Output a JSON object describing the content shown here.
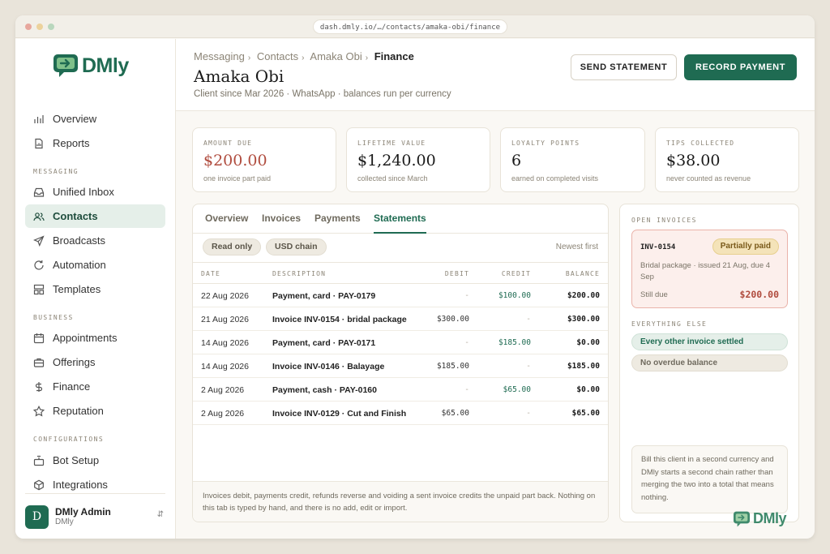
{
  "browser": {
    "url": "dash.dmly.io/…/contacts/amaka-obi/finance"
  },
  "brand": {
    "name": "DMly"
  },
  "sidebar": {
    "top_items": [
      {
        "label": "Overview",
        "icon": "bar-chart-icon"
      },
      {
        "label": "Reports",
        "icon": "report-icon"
      }
    ],
    "sections": [
      {
        "title": "MESSAGING",
        "items": [
          {
            "label": "Unified Inbox",
            "icon": "inbox-icon"
          },
          {
            "label": "Contacts",
            "icon": "users-icon",
            "active": true
          },
          {
            "label": "Broadcasts",
            "icon": "send-icon"
          },
          {
            "label": "Automation",
            "icon": "refresh-icon"
          },
          {
            "label": "Templates",
            "icon": "template-icon"
          }
        ]
      },
      {
        "title": "BUSINESS",
        "items": [
          {
            "label": "Appointments",
            "icon": "calendar-icon"
          },
          {
            "label": "Offerings",
            "icon": "briefcase-icon"
          },
          {
            "label": "Finance",
            "icon": "dollar-icon"
          },
          {
            "label": "Reputation",
            "icon": "star-icon"
          }
        ]
      },
      {
        "title": "CONFIGURATIONS",
        "items": [
          {
            "label": "Bot Setup",
            "icon": "bot-icon"
          },
          {
            "label": "Integrations",
            "icon": "cube-icon"
          }
        ]
      }
    ],
    "user": {
      "initial": "D",
      "name": "DMly Admin",
      "org": "DMly"
    }
  },
  "header": {
    "breadcrumbs": [
      "Messaging",
      "Contacts",
      "Amaka Obi",
      "Finance"
    ],
    "title": "Amaka Obi",
    "subtitle": "Client since Mar 2026 · WhatsApp · balances run per currency",
    "send_statement": "SEND STATEMENT",
    "record_payment": "RECORD PAYMENT"
  },
  "stats": [
    {
      "label": "AMOUNT DUE",
      "value": "$200.00",
      "note": "one invoice part paid"
    },
    {
      "label": "LIFETIME VALUE",
      "value": "$1,240.00",
      "note": "collected since March"
    },
    {
      "label": "LOYALTY POINTS",
      "value": "6",
      "note": "earned on completed visits"
    },
    {
      "label": "TIPS COLLECTED",
      "value": "$38.00",
      "note": "never counted as revenue"
    }
  ],
  "ledger": {
    "tabs": [
      "Overview",
      "Invoices",
      "Payments",
      "Statements"
    ],
    "active_tab": "Statements",
    "chips": [
      "Read only",
      "USD chain"
    ],
    "sort": "Newest first",
    "columns": [
      "DATE",
      "DESCRIPTION",
      "DEBIT",
      "CREDIT",
      "BALANCE"
    ],
    "rows": [
      {
        "date": "22 Aug 2026",
        "desc": "Payment, card · PAY-0179",
        "debit": "-",
        "credit": "$100.00",
        "balance": "$200.00"
      },
      {
        "date": "21 Aug 2026",
        "desc": "Invoice INV-0154 · bridal package",
        "debit": "$300.00",
        "credit": "-",
        "balance": "$300.00"
      },
      {
        "date": "14 Aug 2026",
        "desc": "Payment, card · PAY-0171",
        "debit": "-",
        "credit": "$185.00",
        "balance": "$0.00"
      },
      {
        "date": "14 Aug 2026",
        "desc": "Invoice INV-0146 · Balayage",
        "debit": "$185.00",
        "credit": "-",
        "balance": "$185.00"
      },
      {
        "date": "2 Aug 2026",
        "desc": "Payment, cash · PAY-0160",
        "debit": "-",
        "credit": "$65.00",
        "balance": "$0.00"
      },
      {
        "date": "2 Aug 2026",
        "desc": "Invoice INV-0129 · Cut and Finish",
        "debit": "$65.00",
        "credit": "-",
        "balance": "$65.00"
      }
    ],
    "footnote": "Invoices debit, payments credit, refunds reverse and voiding a sent invoice credits the unpaid part back. Nothing on this tab is typed by hand, and there is no add, edit or import."
  },
  "side": {
    "open_title": "OPEN INVOICES",
    "invoice": {
      "id": "INV-0154",
      "status": "Partially paid",
      "desc": "Bridal package · issued 21 Aug, due 4 Sep",
      "due_label": "Still due",
      "due": "$200.00"
    },
    "else_title": "EVERYTHING ELSE",
    "pills": [
      "Every other invoice settled",
      "No overdue balance"
    ],
    "note": "Bill this client in a second currency and DMly starts a second chain rather than merging the two into a total that means nothing."
  },
  "colors": {
    "accent": "#1f6b52",
    "due": "#b04c3e"
  }
}
